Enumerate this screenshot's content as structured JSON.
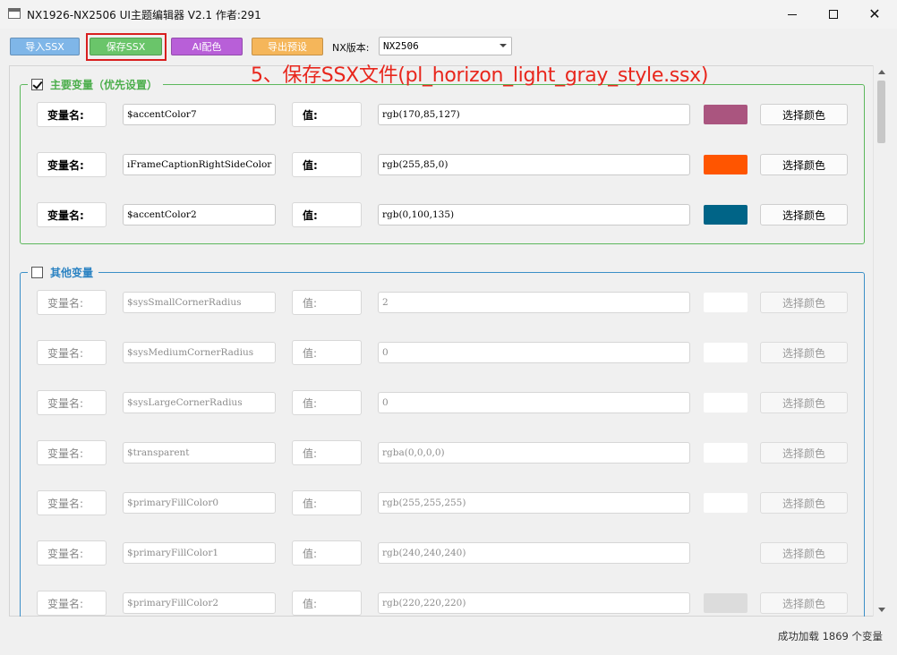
{
  "window": {
    "title": "NX1926-NX2506 UI主题编辑器 V2.1 作者:291",
    "close_glyph": "✕"
  },
  "toolbar": {
    "import_label": "导入SSX",
    "save_label": "保存SSX",
    "ai_label": "AI配色",
    "export_label": "导出预设",
    "version_label": "NX版本:",
    "version_value": "NX2506"
  },
  "annotation": "5、保存SSX文件(pl_horizon_light_gray_style.ssx)",
  "primary_group": {
    "title": "主要变量（优先设置）",
    "checked": true,
    "rows": [
      {
        "name_label": "变量名:",
        "name": "$accentColor7",
        "value_label": "值:",
        "value": "rgb(170,85,127)",
        "color": "#aa557f",
        "button": "选择颜色"
      },
      {
        "name_label": "变量名:",
        "name": "ıFrameCaptionRightSideColor",
        "value_label": "值:",
        "value": "rgb(255,85,0)",
        "color": "#ff5500",
        "button": "选择颜色"
      },
      {
        "name_label": "变量名:",
        "name": "$accentColor2",
        "value_label": "值:",
        "value": "rgb(0,100,135)",
        "color": "#006487",
        "button": "选择颜色"
      }
    ]
  },
  "other_group": {
    "title": "其他变量",
    "checked": false,
    "rows": [
      {
        "name_label": "变量名:",
        "name": "$sysSmallCornerRadius",
        "value_label": "值:",
        "value": "2",
        "color": "#ffffff",
        "button": "选择颜色"
      },
      {
        "name_label": "变量名:",
        "name": "$sysMediumCornerRadius",
        "value_label": "值:",
        "value": "0",
        "color": "#ffffff",
        "button": "选择颜色"
      },
      {
        "name_label": "变量名:",
        "name": "$sysLargeCornerRadius",
        "value_label": "值:",
        "value": "0",
        "color": "#ffffff",
        "button": "选择颜色"
      },
      {
        "name_label": "变量名:",
        "name": "$transparent",
        "value_label": "值:",
        "value": "rgba(0,0,0,0)",
        "color": "#ffffff",
        "button": "选择颜色"
      },
      {
        "name_label": "变量名:",
        "name": "$primaryFillColor0",
        "value_label": "值:",
        "value": "rgb(255,255,255)",
        "color": "#ffffff",
        "button": "选择颜色"
      },
      {
        "name_label": "变量名:",
        "name": "$primaryFillColor1",
        "value_label": "值:",
        "value": "rgb(240,240,240)",
        "color": "#f0f0f0",
        "button": "选择颜色"
      },
      {
        "name_label": "变量名:",
        "name": "$primaryFillColor2",
        "value_label": "值:",
        "value": "rgb(220,220,220)",
        "color": "#dcdcdc",
        "button": "选择颜色"
      }
    ]
  },
  "status": {
    "text": "成功加载 1869 个变量"
  }
}
